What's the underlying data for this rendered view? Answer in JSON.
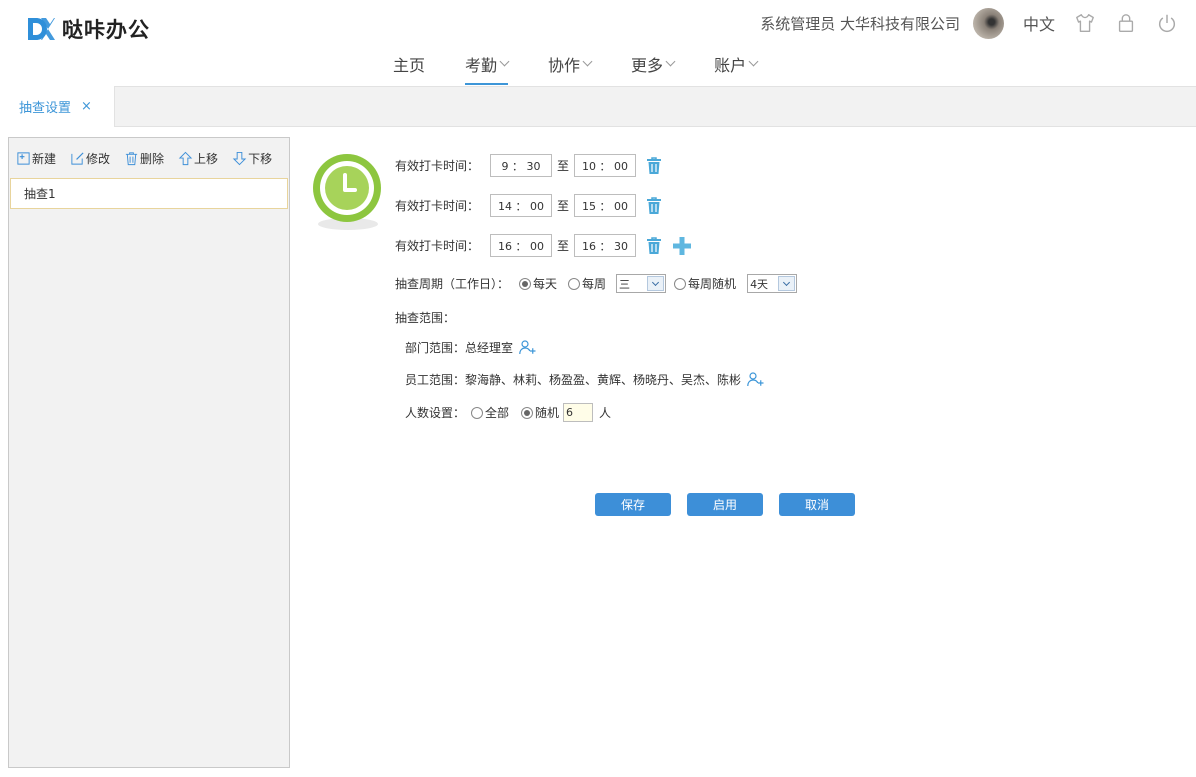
{
  "app": {
    "logo_text": "哒咔办公"
  },
  "header": {
    "user_info": "系统管理员 大华科技有限公司",
    "language": "中文"
  },
  "nav": {
    "items": [
      {
        "label": "主页",
        "dropdown": false
      },
      {
        "label": "考勤",
        "dropdown": true,
        "active": true
      },
      {
        "label": "协作",
        "dropdown": true
      },
      {
        "label": "更多",
        "dropdown": true
      },
      {
        "label": "账户",
        "dropdown": true
      }
    ]
  },
  "tabs": {
    "active_label": "抽查设置",
    "close_symbol": "×"
  },
  "left": {
    "toolbar": {
      "new": "新建",
      "edit": "修改",
      "delete": "删除",
      "up": "上移",
      "down": "下移"
    },
    "items": [
      "抽查1"
    ]
  },
  "form": {
    "time_label": "有效打卡时间：",
    "to_label": "至",
    "times": [
      {
        "start": "9 ： 30",
        "end": "10 ： 00"
      },
      {
        "start": "14 ： 00",
        "end": "15 ： 00"
      },
      {
        "start": "16 ： 00",
        "end": "16 ： 30"
      }
    ],
    "cycle_label": "抽查周期（工作日）：",
    "cycle_daily": "每天",
    "cycle_weekly": "每周",
    "weekly_value": "三",
    "cycle_random": "每周随机",
    "random_value": "4天",
    "scope_label": "抽查范围：",
    "dept_label": "部门范围：",
    "dept_value": "总经理室",
    "staff_label": "员工范围：",
    "staff_value": "黎海静、林莉、杨盈盈、黄辉、杨晓丹、吴杰、陈彬",
    "count_label": "人数设置：",
    "count_all": "全部",
    "count_random": "随机",
    "count_value": "6",
    "count_unit": "人"
  },
  "buttons": {
    "save": "保存",
    "enable": "启用",
    "cancel": "取消"
  },
  "colors": {
    "accent": "#3d96d8",
    "button": "#3d8fd8",
    "clock": "#8dc63f",
    "icon": "#4aa8d8"
  }
}
